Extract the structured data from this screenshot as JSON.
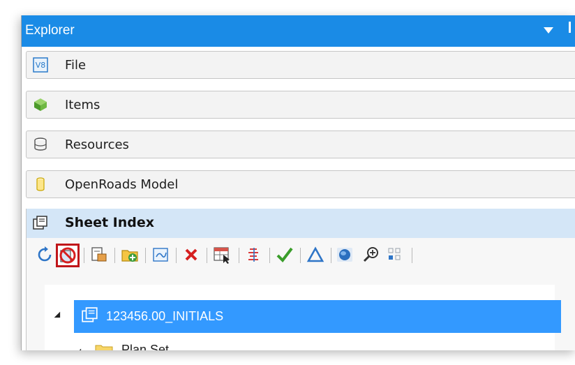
{
  "window": {
    "title": "Explorer"
  },
  "sections": [
    {
      "label": "File",
      "icon": "v8-file-icon"
    },
    {
      "label": "Items",
      "icon": "items-icon"
    },
    {
      "label": "Resources",
      "icon": "resources-icon"
    },
    {
      "label": "OpenRoads Model",
      "icon": "openroads-model-icon"
    }
  ],
  "sheet_index": {
    "label": "Sheet Index",
    "toolbar": [
      "refresh-icon",
      "disable-icon",
      "sheet-properties-icon",
      "add-folder-icon",
      "add-sheet-icon",
      "delete-icon",
      "table-select-icon",
      "link-icon",
      "checkmark-icon",
      "delta-icon",
      "globe-icon",
      "zoom-icon",
      "grid-icon"
    ],
    "tree": {
      "root": "123456.00_INITIALS",
      "child": "Plan Set"
    }
  },
  "colors": {
    "accent": "#1a8be6",
    "selection": "#3399ff",
    "highlight_border": "#c0161a"
  }
}
